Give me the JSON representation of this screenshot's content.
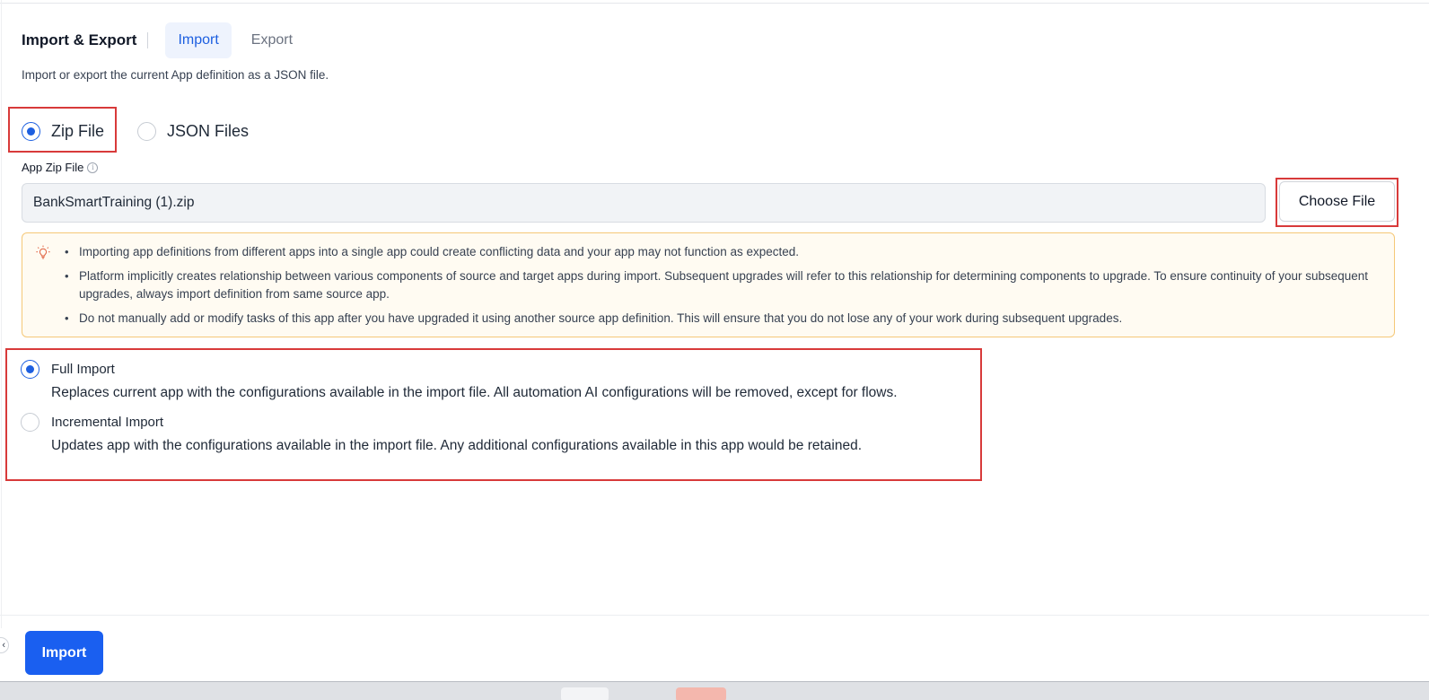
{
  "header": {
    "title": "Import & Export",
    "tabs": [
      {
        "label": "Import",
        "active": true
      },
      {
        "label": "Export",
        "active": false
      }
    ]
  },
  "subtitle": "Import or export the current App definition as a JSON file.",
  "file_type": {
    "options": [
      {
        "label": "Zip File",
        "checked": true
      },
      {
        "label": "JSON Files",
        "checked": false
      }
    ]
  },
  "file_field": {
    "label": "App Zip File",
    "value": "BankSmartTraining (1).zip",
    "choose_label": "Choose File",
    "info_icon": "info-icon"
  },
  "notice": {
    "icon": "lightbulb-icon",
    "items": [
      "Importing app definitions from different apps into a single app could create conflicting data and your app may not function as expected.",
      "Platform implicitly creates relationship between various components of source and target apps during import. Subsequent upgrades will refer to this relationship for determining components to upgrade. To ensure continuity of your subsequent upgrades, always import definition from same source app.",
      "Do not manually add or modify tasks of this app after you have upgraded it using another source app definition. This will ensure that you do not lose any of your work during subsequent upgrades."
    ]
  },
  "import_mode": {
    "options": [
      {
        "label": "Full Import",
        "checked": true,
        "description": "Replaces current app with the configurations available in the import file. All automation AI configurations will be removed, except for flows."
      },
      {
        "label": "Incremental Import",
        "checked": false,
        "description": "Updates app with the configurations available in the import file. Any additional configurations available in this app would be retained."
      }
    ]
  },
  "footer": {
    "import_label": "Import",
    "collapse_icon": "chevron-left-icon"
  },
  "colors": {
    "accent": "#1d5fe0",
    "primary_button": "#1a5ff0",
    "highlight_box": "#d83a3a",
    "notice_border": "#f5c878",
    "notice_bg": "#fffbf2"
  }
}
